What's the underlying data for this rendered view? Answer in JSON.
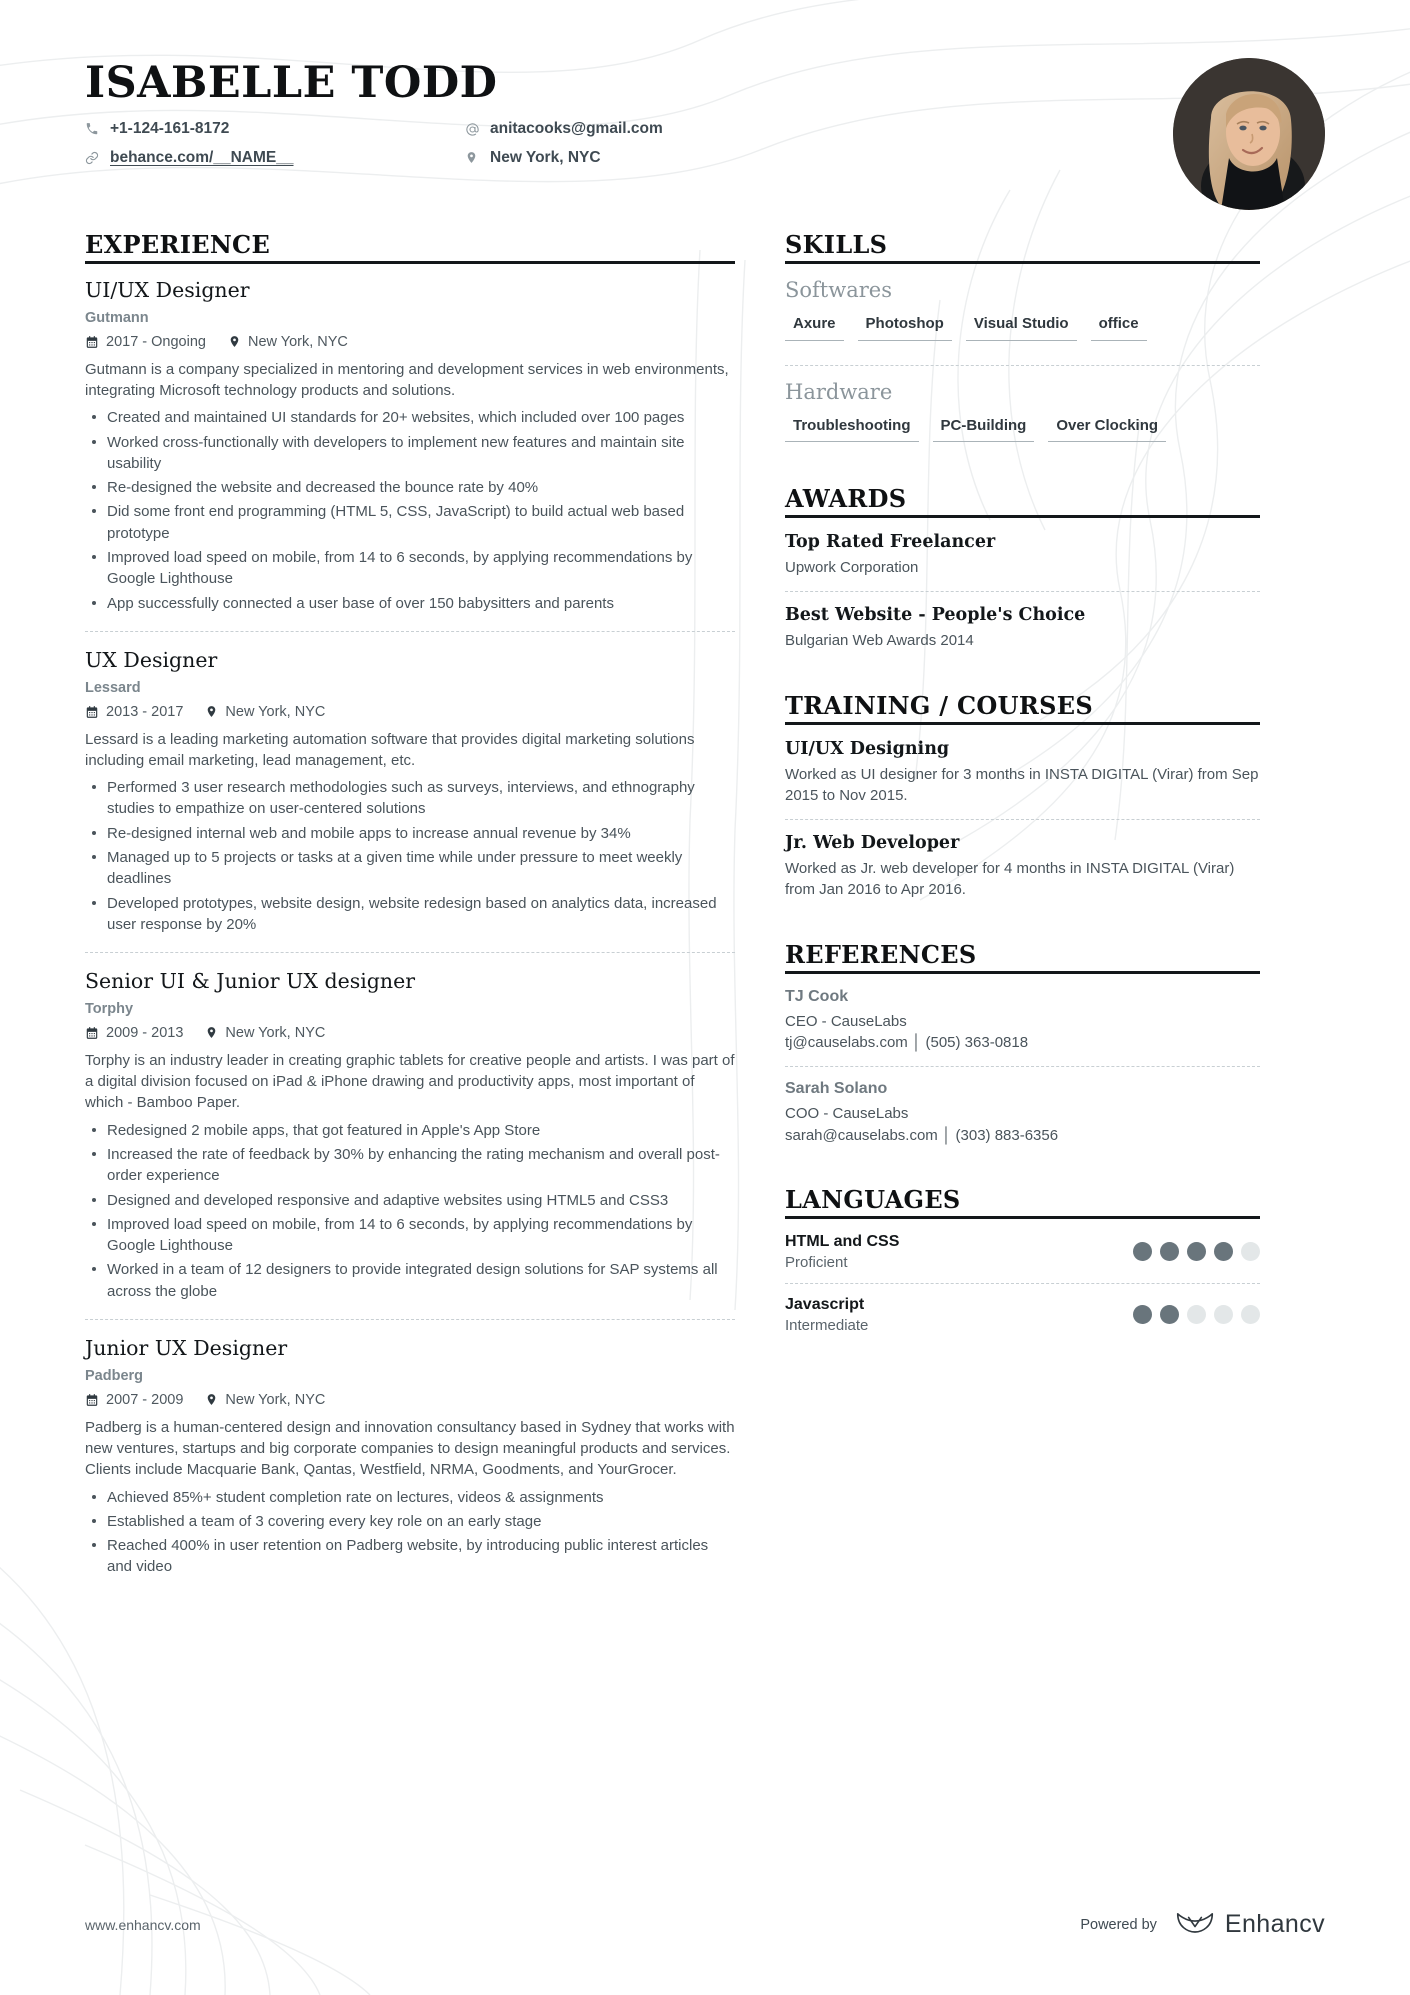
{
  "header": {
    "name": "ISABELLE TODD",
    "contacts_left": [
      {
        "icon": "phone-icon",
        "text": "+1-124-161-8172",
        "underlined": false
      },
      {
        "icon": "link-icon",
        "text": "behance.com/__NAME__",
        "underlined": true
      }
    ],
    "contacts_right": [
      {
        "icon": "at-icon",
        "text": "anitacooks@gmail.com",
        "underlined": false
      },
      {
        "icon": "location-pin-icon",
        "text": "New York, NYC",
        "underlined": false
      }
    ]
  },
  "experience": {
    "title": "EXPERIENCE",
    "jobs": [
      {
        "title": "UI/UX Designer",
        "company": "Gutmann",
        "dates": "2017 - Ongoing",
        "location": "New York, NYC",
        "description": "Gutmann is a company specialized in mentoring and development services in web environments, integrating Microsoft technology products      and  solutions.",
        "bullets": [
          "Created and maintained UI standards for 20+ websites, which included over 100 pages",
          "Worked cross-functionally with developers to implement new features and maintain site usability",
          "Re-designed the website and decreased the bounce rate by 40%",
          "Did some front end programming (HTML 5, CSS, JavaScript) to build actual web based prototype",
          "Improved load speed on mobile, from 14 to 6 seconds, by applying recommendations by Google Lighthouse",
          "App successfully connected a user base of over 150 babysitters and parents"
        ]
      },
      {
        "title": "UX Designer",
        "company": "Lessard",
        "dates": "2013 - 2017",
        "location": "New York, NYC",
        "description": "Lessard is a leading marketing automation software that provides digital marketing solutions including email marketing, lead management, etc.",
        "bullets": [
          "Performed 3 user research methodologies such as surveys, interviews, and ethnography studies to empathize on user-centered solutions",
          "Re-designed internal web and mobile apps to increase annual revenue by 34%",
          "Managed up to 5 projects or tasks at a given time while under pressure to meet weekly deadlines",
          "Developed prototypes, website design, website redesign based on analytics data, increased user response by 20%"
        ]
      },
      {
        "title": "Senior UI & Junior UX designer",
        "company": "Torphy",
        "dates": "2009 - 2013",
        "location": "New York, NYC",
        "description": "Torphy is an industry leader in creating graphic tablets for creative people and artists. I was part of a digital division focused on iPad & iPhone drawing and productivity apps, most important of which - Bamboo Paper.",
        "bullets": [
          "Redesigned 2 mobile apps, that got featured in Apple's App Store",
          "Increased the rate of feedback by 30% by enhancing the rating mechanism and overall post-order experience",
          "Designed and developed responsive and adaptive websites using HTML5 and CSS3",
          "Improved load speed on mobile, from 14 to 6 seconds, by applying recommendations by Google Lighthouse",
          "Worked in a team of 12 designers to provide integrated design solutions for SAP systems all across the globe"
        ]
      },
      {
        "title": "Junior UX Designer",
        "company": "Padberg",
        "dates": "2007 - 2009",
        "location": "New York, NYC",
        "description": "Padberg is a human-centered design and innovation consultancy based in Sydney that works with new ventures, startups and big corporate companies to design meaningful products and services. Clients include Macquarie Bank, Qantas, Westfield, NRMA, Goodments, and YourGrocer.",
        "bullets": [
          "Achieved 85%+ student completion rate on lectures, videos & assignments",
          "Established a team of 3 covering every key role on an early stage",
          "Reached 400% in user retention on Padberg website, by introducing public interest articles and video"
        ]
      }
    ]
  },
  "skills": {
    "title": "SKILLS",
    "groups": [
      {
        "name": "Softwares",
        "tags": [
          "Axure",
          "Photoshop",
          "Visual Studio",
          "office"
        ]
      },
      {
        "name": "Hardware",
        "tags": [
          "Troubleshooting",
          "PC-Building",
          "Over Clocking"
        ]
      }
    ]
  },
  "awards": {
    "title": "AWARDS",
    "items": [
      {
        "title": "Top Rated Freelancer",
        "sub": "Upwork Corporation"
      },
      {
        "title": "Best Website - People's Choice",
        "sub": "Bulgarian Web Awards 2014"
      }
    ]
  },
  "training": {
    "title": "TRAINING / COURSES",
    "items": [
      {
        "title": "UI/UX Designing",
        "sub": "Worked as UI designer for 3 months in INSTA DIGITAL (Virar) from Sep 2015 to Nov 2015."
      },
      {
        "title": "Jr. Web Developer",
        "sub": "Worked as Jr. web developer for 4 months in INSTA DIGITAL (Virar) from Jan 2016 to Apr 2016."
      }
    ]
  },
  "references": {
    "title": "REFERENCES",
    "items": [
      {
        "name": "TJ Cook",
        "role": "CEO - CauseLabs",
        "contact": "tj@causelabs.com │ (505) 363-0818"
      },
      {
        "name": "Sarah Solano",
        "role": "COO - CauseLabs",
        "contact": "sarah@causelabs.com │ (303) 883-6356"
      }
    ]
  },
  "languages": {
    "title": "LANGUAGES",
    "items": [
      {
        "name": "HTML and CSS",
        "level": "Proficient",
        "rating": 4,
        "max": 5
      },
      {
        "name": "Javascript",
        "level": "Intermediate",
        "rating": 2,
        "max": 5
      }
    ]
  },
  "footer": {
    "url": "www.enhancv.com",
    "powered_by": "Powered by",
    "brand": "Enhancv"
  },
  "colors": {
    "text": "#3f4a52",
    "heading": "#13171a",
    "muted": "#7b868d",
    "dot_filled": "#69757c",
    "dot_empty": "#e3e7e8",
    "divider": "#c8cfd3"
  }
}
